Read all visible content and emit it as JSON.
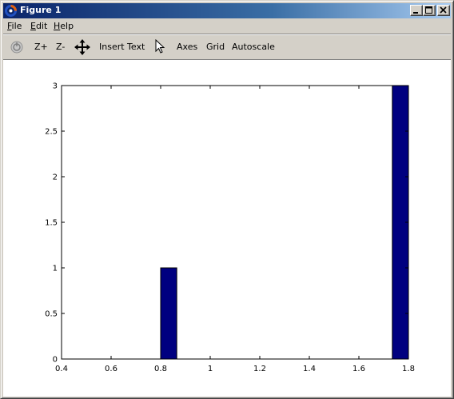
{
  "window": {
    "title": "Figure 1",
    "controls": {
      "minimize_icon": "minimize-icon",
      "maximize_icon": "maximize-icon",
      "close_icon": "close-icon"
    }
  },
  "menu": [
    {
      "label": "File",
      "accel": "F",
      "rest": "ile"
    },
    {
      "label": "Edit",
      "accel": "E",
      "rest": "dit"
    },
    {
      "label": "Help",
      "accel": "H",
      "rest": "elp"
    }
  ],
  "toolbar": {
    "home_icon": "home-icon",
    "zoom_in": "Z+",
    "zoom_out": "Z-",
    "pan_icon": "pan-arrows-icon",
    "insert_text": "Insert Text",
    "pointer_icon": "pointer-icon",
    "axes": "Axes",
    "grid": "Grid",
    "autoscale": "Autoscale"
  },
  "colors": {
    "bar": "#000080",
    "title_start": "#0a246a",
    "title_end": "#a6caf0",
    "chrome": "#d4d0c8"
  },
  "chart_data": {
    "type": "bar",
    "bars": [
      {
        "x_start": 0.8,
        "x_end": 0.865,
        "value": 1
      },
      {
        "x_start": 1.735,
        "x_end": 1.8,
        "value": 3
      }
    ],
    "xlim": [
      0.4,
      1.8
    ],
    "ylim": [
      0,
      3
    ],
    "xticks": [
      "0.4",
      "0.6",
      "0.8",
      "1",
      "1.2",
      "1.4",
      "1.6",
      "1.8"
    ],
    "xtick_values": [
      0.4,
      0.6,
      0.8,
      1.0,
      1.2,
      1.4,
      1.6,
      1.8
    ],
    "yticks": [
      "0",
      "0.5",
      "1",
      "1.5",
      "2",
      "2.5",
      "3"
    ],
    "ytick_values": [
      0,
      0.5,
      1,
      1.5,
      2,
      2.5,
      3
    ],
    "grid": false,
    "title": "",
    "xlabel": "",
    "ylabel": ""
  }
}
